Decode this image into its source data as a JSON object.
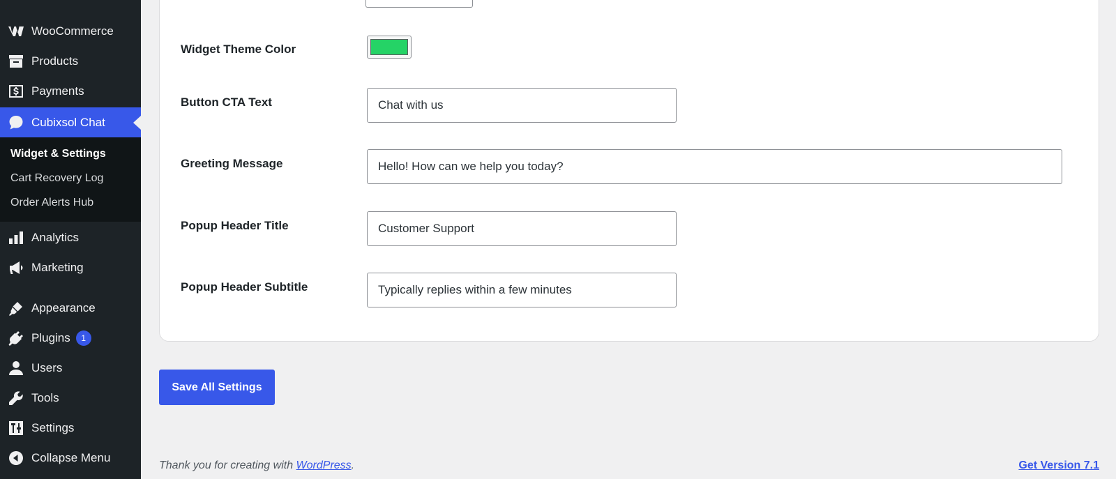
{
  "sidebar": {
    "items": [
      {
        "label": "WooCommerce",
        "icon": "woocommerce-icon"
      },
      {
        "label": "Products",
        "icon": "archive-icon"
      },
      {
        "label": "Payments",
        "icon": "dollar-icon"
      },
      {
        "label": "Cubixsol Chat",
        "icon": "chat-bubble-icon",
        "current": true
      },
      {
        "label": "Analytics",
        "icon": "bar-chart-icon"
      },
      {
        "label": "Marketing",
        "icon": "megaphone-icon"
      },
      {
        "label": "Appearance",
        "icon": "paintbrush-icon"
      },
      {
        "label": "Plugins",
        "icon": "plug-icon",
        "badge": "1"
      },
      {
        "label": "Users",
        "icon": "user-icon"
      },
      {
        "label": "Tools",
        "icon": "wrench-icon"
      },
      {
        "label": "Settings",
        "icon": "sliders-icon"
      },
      {
        "label": "Collapse Menu",
        "icon": "collapse-arrow-icon"
      }
    ],
    "submenu": [
      {
        "label": "Widget & Settings",
        "current": true
      },
      {
        "label": "Cart Recovery Log"
      },
      {
        "label": "Order Alerts Hub"
      }
    ]
  },
  "form": {
    "theme_color": {
      "label": "Widget Theme Color",
      "value": "#25d366"
    },
    "cta_text": {
      "label": "Button CTA Text",
      "value": "Chat with us"
    },
    "greeting": {
      "label": "Greeting Message",
      "value": "Hello! How can we help you today?"
    },
    "popup_title": {
      "label": "Popup Header Title",
      "value": "Customer Support"
    },
    "popup_subtitle": {
      "label": "Popup Header Subtitle",
      "value": "Typically replies within a few minutes"
    }
  },
  "actions": {
    "save_label": "Save All Settings"
  },
  "footer": {
    "thanks_prefix": "Thank you for creating with ",
    "thanks_link": "WordPress",
    "thanks_suffix": ".",
    "version_link": "Get Version 7.1"
  },
  "colors": {
    "sidebar_bg": "#1d2327",
    "submenu_bg": "#101517",
    "accent": "#3858e9",
    "page_bg": "#f0f0f1"
  }
}
